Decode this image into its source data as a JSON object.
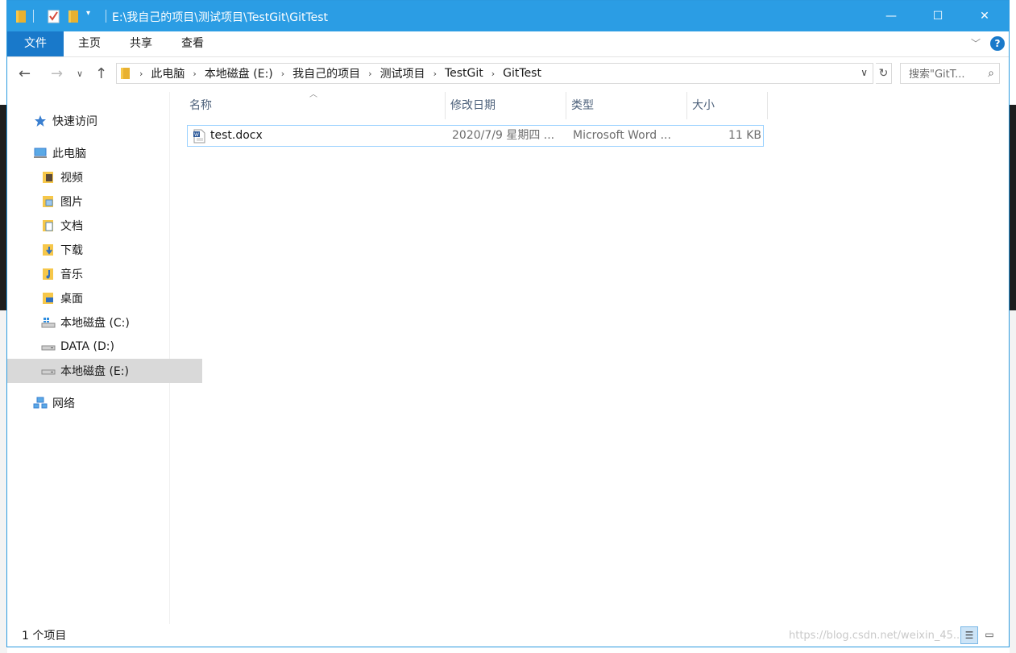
{
  "window": {
    "title": "E:\\我自己的项目\\测试项目\\TestGit\\GitTest",
    "controls": {
      "minimize": "—",
      "maximize": "☐",
      "close": "✕"
    }
  },
  "ribbon": {
    "tabs": [
      "文件",
      "主页",
      "共享",
      "查看"
    ],
    "help": "?"
  },
  "address": {
    "crumbs": [
      "此电脑",
      "本地磁盘 (E:)",
      "我自己的项目",
      "测试项目",
      "TestGit",
      "GitTest"
    ]
  },
  "search": {
    "placeholder": "搜索\"GitT..."
  },
  "sidebar": {
    "items": [
      {
        "label": "快速访问",
        "icon": "star-icon"
      },
      {
        "label": "此电脑",
        "icon": "computer-icon"
      },
      {
        "label": "视频",
        "icon": "video-folder-icon"
      },
      {
        "label": "图片",
        "icon": "pictures-folder-icon"
      },
      {
        "label": "文档",
        "icon": "documents-folder-icon"
      },
      {
        "label": "下载",
        "icon": "downloads-folder-icon"
      },
      {
        "label": "音乐",
        "icon": "music-folder-icon"
      },
      {
        "label": "桌面",
        "icon": "desktop-folder-icon"
      },
      {
        "label": "本地磁盘 (C:)",
        "icon": "system-drive-icon"
      },
      {
        "label": "DATA (D:)",
        "icon": "drive-icon"
      },
      {
        "label": "本地磁盘 (E:)",
        "icon": "drive-icon",
        "selected": true
      },
      {
        "label": "网络",
        "icon": "network-icon"
      }
    ]
  },
  "columns": [
    "名称",
    "修改日期",
    "类型",
    "大小"
  ],
  "files": [
    {
      "name": "test.docx",
      "date": "2020/7/9 星期四 ...",
      "type": "Microsoft Word ...",
      "size": "11 KB",
      "icon": "word-document-icon"
    }
  ],
  "status": {
    "count": "1 个项目",
    "watermark": "https://blog.csdn.net/weixin_45..."
  },
  "colors": {
    "titlebar": "#2b9de4",
    "file_tab": "#1979ca",
    "selection_border": "#99d1ff",
    "selected_nav": "#d9d9d9"
  }
}
